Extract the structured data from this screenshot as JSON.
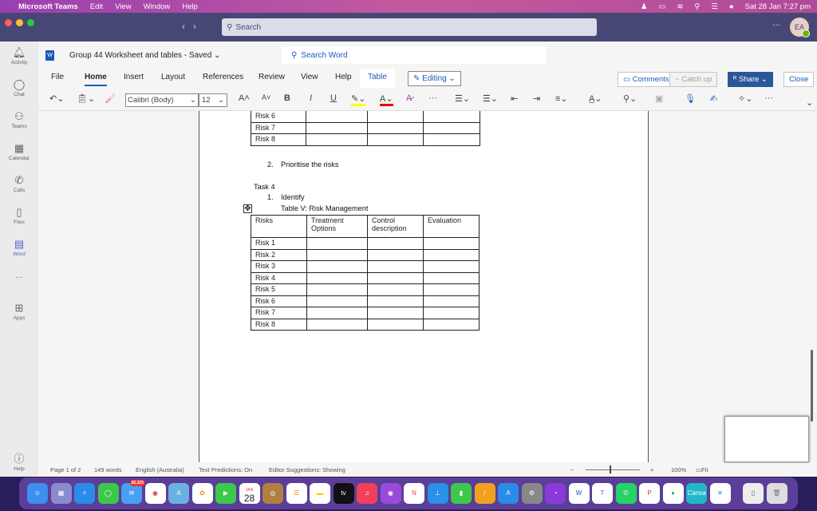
{
  "menubar": {
    "app": "Microsoft Teams",
    "items": [
      "Edit",
      "View",
      "Window",
      "Help"
    ],
    "clock": "Sat 28 Jan  7:27 pm"
  },
  "teams": {
    "search_placeholder": "Search",
    "avatar": "EA",
    "more": "···"
  },
  "rail": [
    {
      "label": "Activity",
      "icon": "bell-icon"
    },
    {
      "label": "Chat",
      "icon": "chat-icon"
    },
    {
      "label": "Teams",
      "icon": "teams-icon"
    },
    {
      "label": "Calendar",
      "icon": "calendar-icon"
    },
    {
      "label": "Calls",
      "icon": "phone-icon"
    },
    {
      "label": "Files",
      "icon": "file-icon"
    },
    {
      "label": "Word",
      "icon": "word-icon",
      "active": true
    },
    {
      "label": "···",
      "icon": "more-icon"
    },
    {
      "label": "Apps",
      "icon": "apps-icon"
    },
    {
      "label": "Help",
      "icon": "help-icon"
    }
  ],
  "word": {
    "title": "Group 44 Worksheet and tables  -  Saved",
    "search_placeholder": "Search Word",
    "tabs": [
      "File",
      "Home",
      "Insert",
      "Layout",
      "References",
      "Review",
      "View",
      "Help",
      "Table"
    ],
    "active_tab": "Home",
    "editing": "Editing",
    "comments": "Comments",
    "catch_up": "Catch up",
    "share": "Share",
    "close": "Close",
    "font": "Calibri (Body)",
    "font_size": "12"
  },
  "document": {
    "top_table_rows": [
      "Risk 6",
      "Risk 7",
      "Risk 8"
    ],
    "item2": "2.",
    "item2_text": "Prioritise the risks",
    "task": "Task 4",
    "item1": "1.",
    "item1_text": "Identify",
    "caption": "Table V: Risk Management",
    "headers": [
      "Risks",
      "Treatment Options",
      "Control description",
      "Evaluation"
    ],
    "rows": [
      "Risk 1",
      "Risk 2",
      "Risk 3",
      "Risk 4",
      "Risk 5",
      "Risk 6",
      "Risk 7",
      "Risk 8"
    ]
  },
  "status": {
    "page": "Page 1 of 2",
    "words": "149 words",
    "language": "English (Australia)",
    "predictions": "Text Predictions: On",
    "editor": "Editor Suggestions: Showing",
    "zoom": "100%",
    "fit": "Fit",
    "zoom_minus": "−",
    "zoom_plus": "+"
  },
  "dock": {
    "mail_badge": "82,325",
    "calendar_day": "28",
    "calendar_month": "JAN",
    "tv": "tv",
    "canva": "Canva"
  }
}
